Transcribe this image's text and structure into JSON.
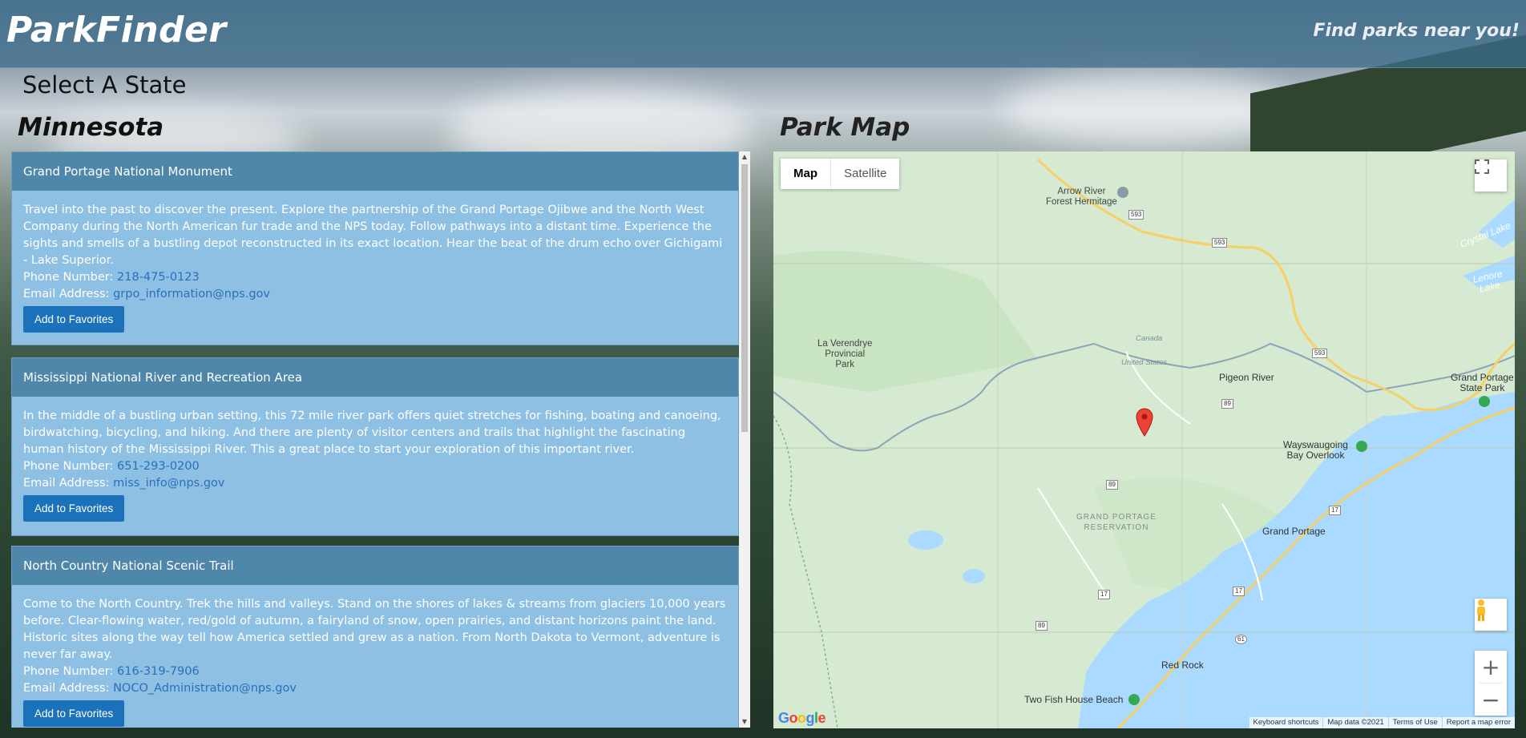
{
  "header": {
    "brand": "ParkFinder",
    "tagline": "Find parks near you!"
  },
  "page": {
    "select_state_label": "Select A State",
    "state_name": "Minnesota",
    "map_heading": "Park Map"
  },
  "parks": [
    {
      "name": "Grand Portage National Monument",
      "description": "Travel into the past to discover the present. Explore the partnership of the Grand Portage Ojibwe and the North West Company during the North American fur trade and the NPS today. Follow pathways into a distant time. Experience the sights and smells of a bustling depot reconstructed in its exact location. Hear the beat of the drum echo over Gichigami - Lake Superior.",
      "phone_label": "Phone Number:",
      "phone": "218-475-0123",
      "email_label": "Email Address:",
      "email": "grpo_information@nps.gov",
      "button": "Add to Favorites"
    },
    {
      "name": "Mississippi National River and Recreation Area",
      "description": "In the middle of a bustling urban setting, this 72 mile river park offers quiet stretches for fishing, boating and canoeing, birdwatching, bicycling, and hiking. And there are plenty of visitor centers and trails that highlight the fascinating human history of the Mississippi River. This a great place to start your exploration of this important river.",
      "phone_label": "Phone Number:",
      "phone": "651-293-0200",
      "email_label": "Email Address:",
      "email": "miss_info@nps.gov",
      "button": "Add to Favorites"
    },
    {
      "name": "North Country National Scenic Trail",
      "description": "Come to the North Country. Trek the hills and valleys. Stand on the shores of lakes & streams from glaciers 10,000 years before. Clear-flowing water, red/gold of autumn, a fairyland of snow, open prairies, and distant horizons paint the land. Historic sites along the way tell how America settled and grew as a nation. From North Dakota to Vermont, adventure is never far away.",
      "phone_label": "Phone Number:",
      "phone": "616-319-7906",
      "email_label": "Email Address:",
      "email": "NOCO_Administration@nps.gov",
      "button": "Add to Favorites"
    }
  ],
  "map": {
    "type_buttons": {
      "map": "Map",
      "satellite": "Satellite"
    },
    "places": {
      "arrow_river": "Arrow River\nForest Hermitage",
      "la_verendrye": "La Verendrye\nProvincial\nPark",
      "pigeon_river": "Pigeon River",
      "grand_portage_sp": "Grand Portage\nState Park",
      "wayswaugoing": "Wayswaugoing\nBay Overlook",
      "reservation": "GRAND PORTAGE\nRESERVATION",
      "grand_portage": "Grand Portage",
      "red_rock": "Red Rock",
      "two_fish": "Two Fish House Beach",
      "crystal_lake": "Crystal Lake",
      "lenore_lake": "Lenore Lake",
      "canada": "Canada",
      "united_states": "United States"
    },
    "road_numbers": [
      "593",
      "593",
      "593",
      "89",
      "89",
      "89",
      "17",
      "17",
      "17",
      "61"
    ],
    "attribution": {
      "shortcuts": "Keyboard shortcuts",
      "data": "Map data ©2021",
      "terms": "Terms of Use",
      "report": "Report a map error"
    },
    "logo": "Google",
    "colors": {
      "land": "#d7ebd3",
      "water": "#aadaff",
      "road": "#f6cf65",
      "marker": "#ea4335"
    }
  }
}
